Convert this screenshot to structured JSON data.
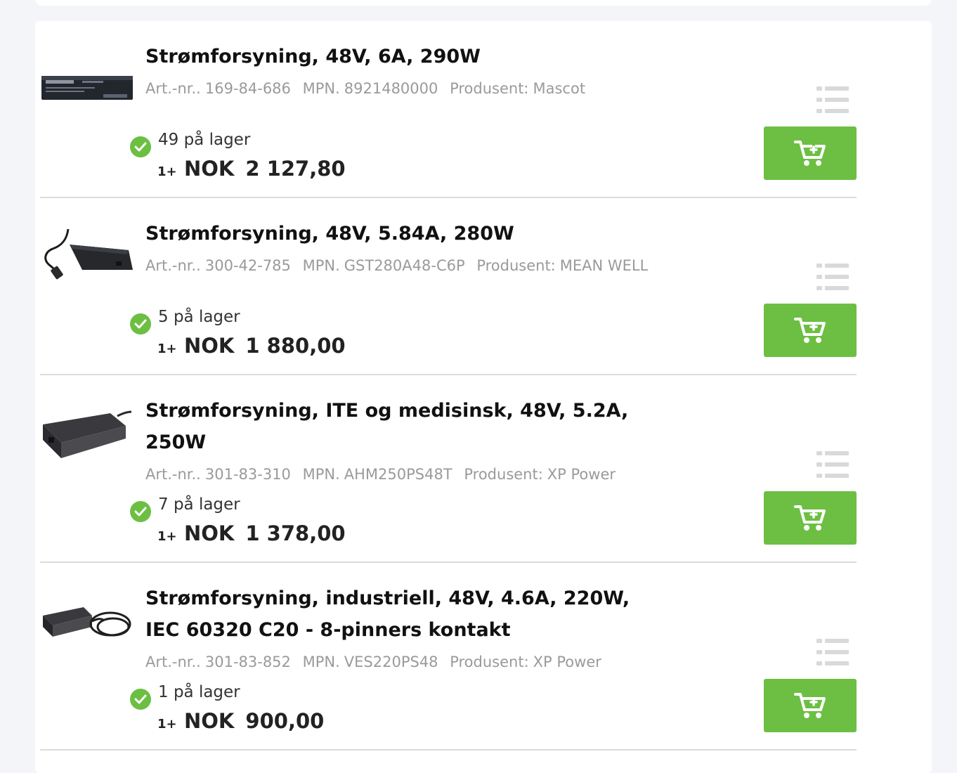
{
  "labels": {
    "art_prefix": "Art.-nr..",
    "mpn_prefix": "MPN.",
    "manufacturer_prefix": "Produsent:",
    "qty_prefix": "1+",
    "currency": "NOK"
  },
  "colors": {
    "accent_green": "#6cbf42",
    "meta_gray": "#9a9a9a",
    "divider": "#dcdcdc"
  },
  "products": [
    {
      "title": "Strømforsyning, 48V, 6A, 290W",
      "art_nr": "169-84-686",
      "mpn": "8921480000",
      "manufacturer": "Mascot",
      "stock": "49 på lager",
      "price": "2 127,80"
    },
    {
      "title": "Strømforsyning, 48V, 5.84A, 280W",
      "art_nr": "300-42-785",
      "mpn": "GST280A48-C6P",
      "manufacturer": "MEAN WELL",
      "stock": "5 på lager",
      "price": "1 880,00"
    },
    {
      "title": "Strømforsyning, ITE og medisinsk, 48V, 5.2A, 250W",
      "art_nr": "301-83-310",
      "mpn": "AHM250PS48T",
      "manufacturer": "XP Power",
      "stock": "7 på lager",
      "price": "1 378,00"
    },
    {
      "title": "Strømforsyning, industriell, 48V, 4.6A, 220W, IEC 60320 C20 - 8-pinners kontakt",
      "art_nr": "301-83-852",
      "mpn": "VES220PS48",
      "manufacturer": "XP Power",
      "stock": "1 på lager",
      "price": "900,00"
    }
  ],
  "icons": {
    "stock": "check-circle-icon",
    "details": "list-icon",
    "cart": "add-to-cart-icon"
  }
}
